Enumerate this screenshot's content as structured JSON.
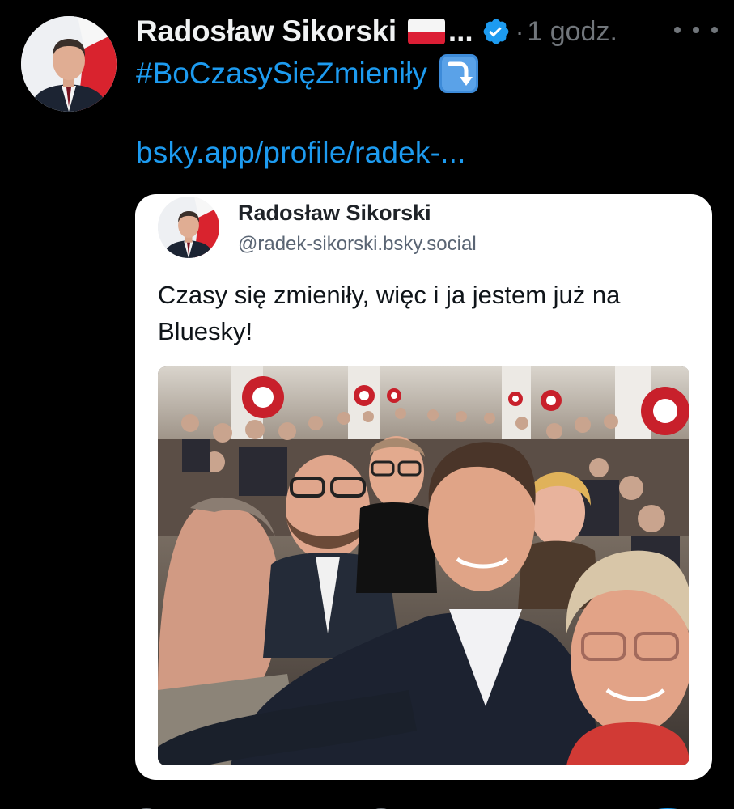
{
  "post": {
    "author_name": "Radosław Sikorski",
    "ellipsis": "...",
    "dot": "·",
    "timestamp": "1 godz.",
    "hashtag": "#BoCzasySięZmieniły",
    "link_text": "bsky.app/profile/radek-..."
  },
  "quoted_post": {
    "author_name": "Radosław Sikorski",
    "handle": "@radek-sikorski.bsky.social",
    "text": "Czasy się zmieniły, więc i ja jestem już na Bluesky!"
  },
  "icons": {
    "flag": "poland-flag-icon",
    "verified": "verified-badge-icon",
    "more": "more-options-icon",
    "arrow": "arrow-down-right-icon"
  },
  "colors": {
    "background": "#000000",
    "link": "#1d9bf0",
    "secondary_text": "#71767b",
    "card_background": "#ffffff"
  }
}
